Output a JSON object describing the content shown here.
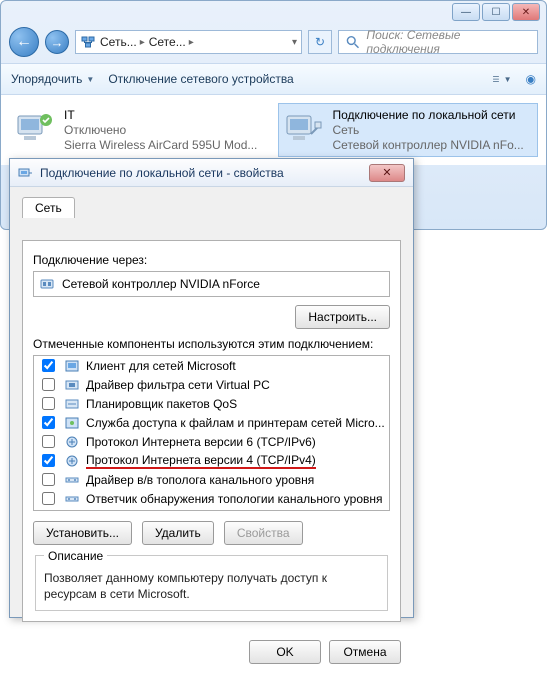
{
  "explorer": {
    "breadcrumb": {
      "seg1": "Сеть...",
      "seg2": "Сете..."
    },
    "search_placeholder": "Поиск: Сетевые подключения",
    "toolbar": {
      "organize": "Упорядочить",
      "disable": "Отключение сетевого устройства"
    },
    "connections": [
      {
        "title": "IT",
        "line2": "Отключено",
        "line3": "Sierra Wireless AirCard 595U Mod..."
      },
      {
        "title": "Подключение по локальной сети",
        "line2": "Сеть",
        "line3": "Сетевой контроллер NVIDIA nFo..."
      }
    ]
  },
  "dialog": {
    "title": "Подключение по локальной сети - свойства",
    "tab": "Сеть",
    "connect_using_label": "Подключение через:",
    "adapter": "Сетевой контроллер NVIDIA nForce",
    "configure": "Настроить...",
    "components_label": "Отмеченные компоненты используются этим подключением:",
    "components": [
      {
        "checked": true,
        "label": "Клиент для сетей Microsoft"
      },
      {
        "checked": false,
        "label": "Драйвер фильтра сети Virtual PC"
      },
      {
        "checked": false,
        "label": "Планировщик пакетов QoS"
      },
      {
        "checked": true,
        "label": "Служба доступа к файлам и принтерам сетей Micro..."
      },
      {
        "checked": false,
        "label": "Протокол Интернета версии 6 (TCP/IPv6)"
      },
      {
        "checked": true,
        "label": "Протокол Интернета версии 4 (TCP/IPv4)",
        "highlight": true
      },
      {
        "checked": false,
        "label": "Драйвер в/в тополога канального уровня"
      },
      {
        "checked": false,
        "label": "Ответчик обнаружения топологии канального уровня"
      }
    ],
    "install": "Установить...",
    "uninstall": "Удалить",
    "properties": "Свойства",
    "desc_title": "Описание",
    "desc_text": "Позволяет данному компьютеру получать доступ к ресурсам в сети Microsoft.",
    "ok": "OK",
    "cancel": "Отмена"
  }
}
